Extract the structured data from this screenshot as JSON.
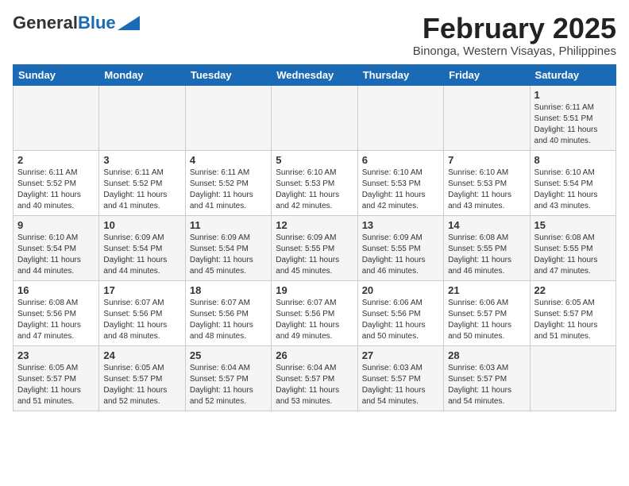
{
  "header": {
    "logo_general": "General",
    "logo_blue": "Blue",
    "month_year": "February 2025",
    "location": "Binonga, Western Visayas, Philippines"
  },
  "calendar": {
    "days_of_week": [
      "Sunday",
      "Monday",
      "Tuesday",
      "Wednesday",
      "Thursday",
      "Friday",
      "Saturday"
    ],
    "weeks": [
      [
        {
          "day": "",
          "info": ""
        },
        {
          "day": "",
          "info": ""
        },
        {
          "day": "",
          "info": ""
        },
        {
          "day": "",
          "info": ""
        },
        {
          "day": "",
          "info": ""
        },
        {
          "day": "",
          "info": ""
        },
        {
          "day": "1",
          "info": "Sunrise: 6:11 AM\nSunset: 5:51 PM\nDaylight: 11 hours\nand 40 minutes."
        }
      ],
      [
        {
          "day": "2",
          "info": "Sunrise: 6:11 AM\nSunset: 5:52 PM\nDaylight: 11 hours\nand 40 minutes."
        },
        {
          "day": "3",
          "info": "Sunrise: 6:11 AM\nSunset: 5:52 PM\nDaylight: 11 hours\nand 41 minutes."
        },
        {
          "day": "4",
          "info": "Sunrise: 6:11 AM\nSunset: 5:52 PM\nDaylight: 11 hours\nand 41 minutes."
        },
        {
          "day": "5",
          "info": "Sunrise: 6:10 AM\nSunset: 5:53 PM\nDaylight: 11 hours\nand 42 minutes."
        },
        {
          "day": "6",
          "info": "Sunrise: 6:10 AM\nSunset: 5:53 PM\nDaylight: 11 hours\nand 42 minutes."
        },
        {
          "day": "7",
          "info": "Sunrise: 6:10 AM\nSunset: 5:53 PM\nDaylight: 11 hours\nand 43 minutes."
        },
        {
          "day": "8",
          "info": "Sunrise: 6:10 AM\nSunset: 5:54 PM\nDaylight: 11 hours\nand 43 minutes."
        }
      ],
      [
        {
          "day": "9",
          "info": "Sunrise: 6:10 AM\nSunset: 5:54 PM\nDaylight: 11 hours\nand 44 minutes."
        },
        {
          "day": "10",
          "info": "Sunrise: 6:09 AM\nSunset: 5:54 PM\nDaylight: 11 hours\nand 44 minutes."
        },
        {
          "day": "11",
          "info": "Sunrise: 6:09 AM\nSunset: 5:54 PM\nDaylight: 11 hours\nand 45 minutes."
        },
        {
          "day": "12",
          "info": "Sunrise: 6:09 AM\nSunset: 5:55 PM\nDaylight: 11 hours\nand 45 minutes."
        },
        {
          "day": "13",
          "info": "Sunrise: 6:09 AM\nSunset: 5:55 PM\nDaylight: 11 hours\nand 46 minutes."
        },
        {
          "day": "14",
          "info": "Sunrise: 6:08 AM\nSunset: 5:55 PM\nDaylight: 11 hours\nand 46 minutes."
        },
        {
          "day": "15",
          "info": "Sunrise: 6:08 AM\nSunset: 5:55 PM\nDaylight: 11 hours\nand 47 minutes."
        }
      ],
      [
        {
          "day": "16",
          "info": "Sunrise: 6:08 AM\nSunset: 5:56 PM\nDaylight: 11 hours\nand 47 minutes."
        },
        {
          "day": "17",
          "info": "Sunrise: 6:07 AM\nSunset: 5:56 PM\nDaylight: 11 hours\nand 48 minutes."
        },
        {
          "day": "18",
          "info": "Sunrise: 6:07 AM\nSunset: 5:56 PM\nDaylight: 11 hours\nand 48 minutes."
        },
        {
          "day": "19",
          "info": "Sunrise: 6:07 AM\nSunset: 5:56 PM\nDaylight: 11 hours\nand 49 minutes."
        },
        {
          "day": "20",
          "info": "Sunrise: 6:06 AM\nSunset: 5:56 PM\nDaylight: 11 hours\nand 50 minutes."
        },
        {
          "day": "21",
          "info": "Sunrise: 6:06 AM\nSunset: 5:57 PM\nDaylight: 11 hours\nand 50 minutes."
        },
        {
          "day": "22",
          "info": "Sunrise: 6:05 AM\nSunset: 5:57 PM\nDaylight: 11 hours\nand 51 minutes."
        }
      ],
      [
        {
          "day": "23",
          "info": "Sunrise: 6:05 AM\nSunset: 5:57 PM\nDaylight: 11 hours\nand 51 minutes."
        },
        {
          "day": "24",
          "info": "Sunrise: 6:05 AM\nSunset: 5:57 PM\nDaylight: 11 hours\nand 52 minutes."
        },
        {
          "day": "25",
          "info": "Sunrise: 6:04 AM\nSunset: 5:57 PM\nDaylight: 11 hours\nand 52 minutes."
        },
        {
          "day": "26",
          "info": "Sunrise: 6:04 AM\nSunset: 5:57 PM\nDaylight: 11 hours\nand 53 minutes."
        },
        {
          "day": "27",
          "info": "Sunrise: 6:03 AM\nSunset: 5:57 PM\nDaylight: 11 hours\nand 54 minutes."
        },
        {
          "day": "28",
          "info": "Sunrise: 6:03 AM\nSunset: 5:57 PM\nDaylight: 11 hours\nand 54 minutes."
        },
        {
          "day": "",
          "info": ""
        }
      ]
    ]
  }
}
